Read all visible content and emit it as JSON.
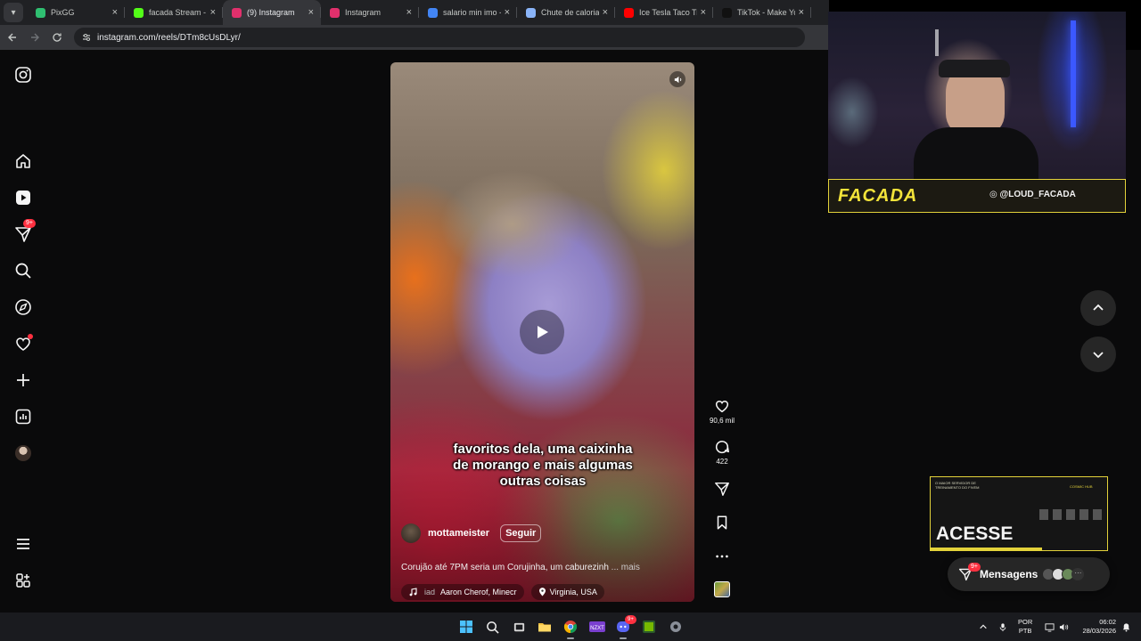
{
  "browser": {
    "tabs": [
      {
        "title": "PixGG",
        "color": "#2fbf71",
        "active": false
      },
      {
        "title": "facada Stream - W",
        "color": "#53fc18",
        "active": false
      },
      {
        "title": "(9) Instagram",
        "color": "#e1306c",
        "active": true
      },
      {
        "title": "Instagram",
        "color": "#e1306c",
        "active": false
      },
      {
        "title": "salario min imo -",
        "color": "#4285f4",
        "active": false
      },
      {
        "title": "Chute de calorias",
        "color": "#8ab4f8",
        "active": false
      },
      {
        "title": "Ice Tesla Taco Tre",
        "color": "#ff0000",
        "active": false
      },
      {
        "title": "TikTok - Make Yo",
        "color": "#111111",
        "active": false
      }
    ],
    "url": "instagram.com/reels/DTm8cUsDLyr/"
  },
  "sidebar": {
    "notifications_badge": "9+",
    "items": [
      "instagram-logo",
      "home",
      "reels",
      "messages",
      "search",
      "explore",
      "notifications",
      "create",
      "dashboard",
      "profile",
      "more",
      "also-from-meta"
    ]
  },
  "reel": {
    "caption_lines": [
      "favoritos dela, uma caixinha",
      "de morango e mais algumas",
      "outras coisas"
    ],
    "author": "mottameister",
    "follow_label": "Seguir",
    "description": "Corujão até 7PM seria um Corujinha, um caburezinh",
    "more_label": "... mais",
    "audio_prefix": "iad",
    "audio": "Aaron Cherof, Minecr",
    "location": "Virginia, USA"
  },
  "actions": {
    "likes": "90,6 mil",
    "comments": "422"
  },
  "overlay": {
    "banner_logo": "FACADA",
    "banner_handle": "◎ @LOUD_FACADA",
    "ad_small_text": "O MAIOR SERVIDOR DE TREINAMENTO DO FIVEM",
    "ad_brand": "COSMIC HUB",
    "ad_title": "ACESSE"
  },
  "messages": {
    "label": "Mensagens",
    "badge": "9+"
  },
  "taskbar": {
    "lang_top": "POR",
    "lang_bottom": "PTB",
    "time": "06:02",
    "date": "28/03/2026",
    "discord_badge": "9+"
  }
}
